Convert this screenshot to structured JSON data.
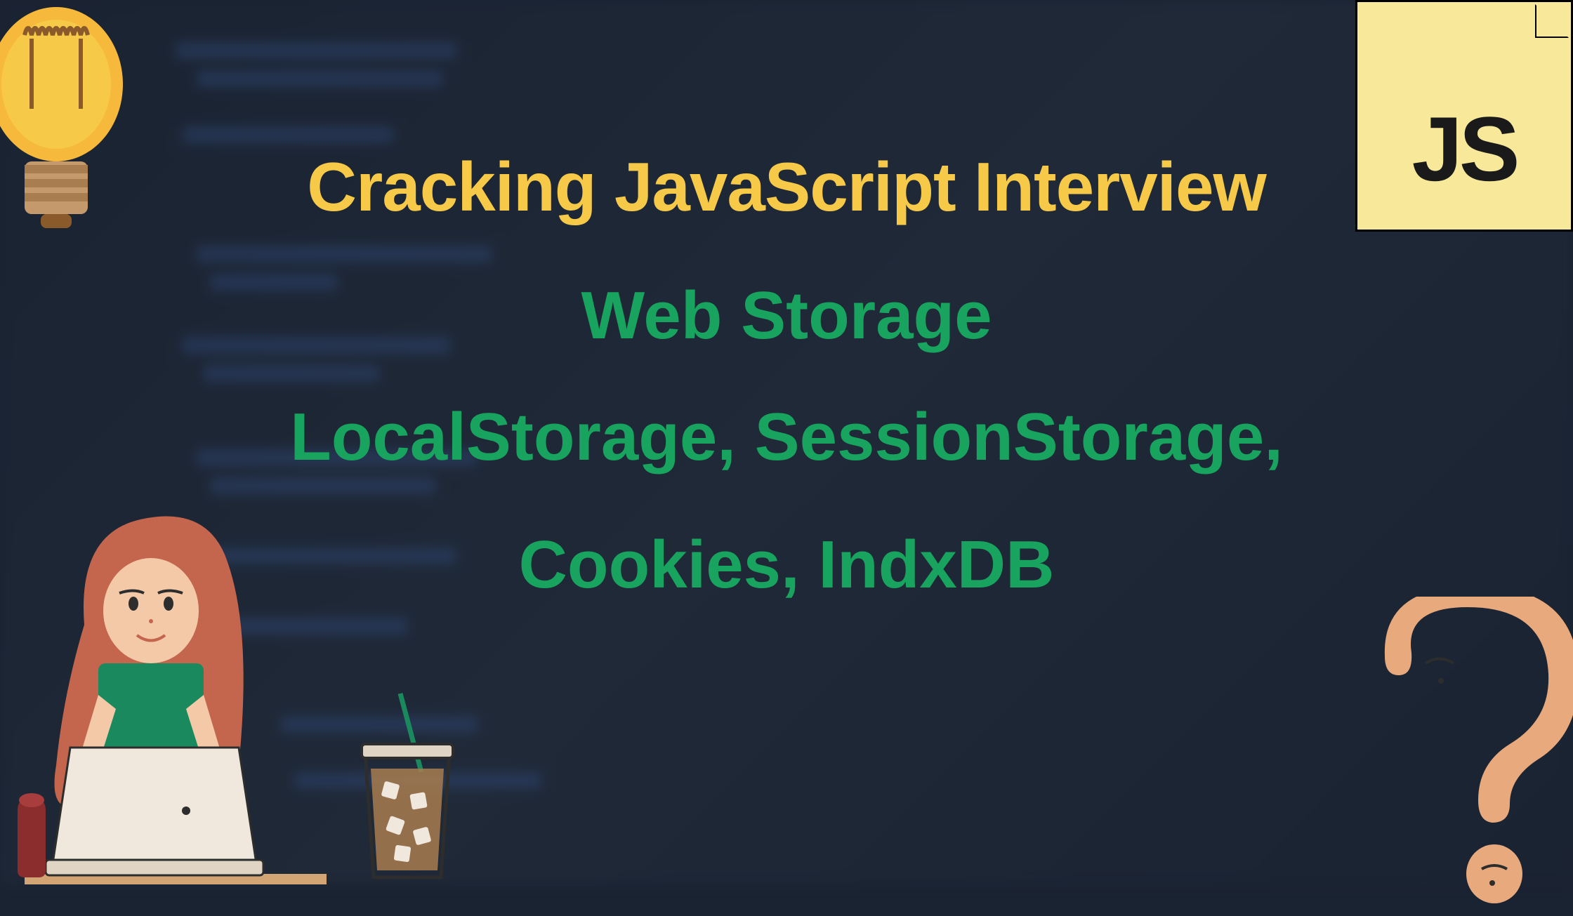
{
  "title": "Cracking JavaScript Interview",
  "subtitle1": "Web Storage",
  "subtitle2": "LocalStorage, SessionStorage,",
  "subtitle3": "Cookies, IndxDB",
  "badge": "JS",
  "colors": {
    "yellow": "#f7c948",
    "green": "#18a35e",
    "badge_bg": "#f7e89a",
    "background": "#1a2332"
  }
}
